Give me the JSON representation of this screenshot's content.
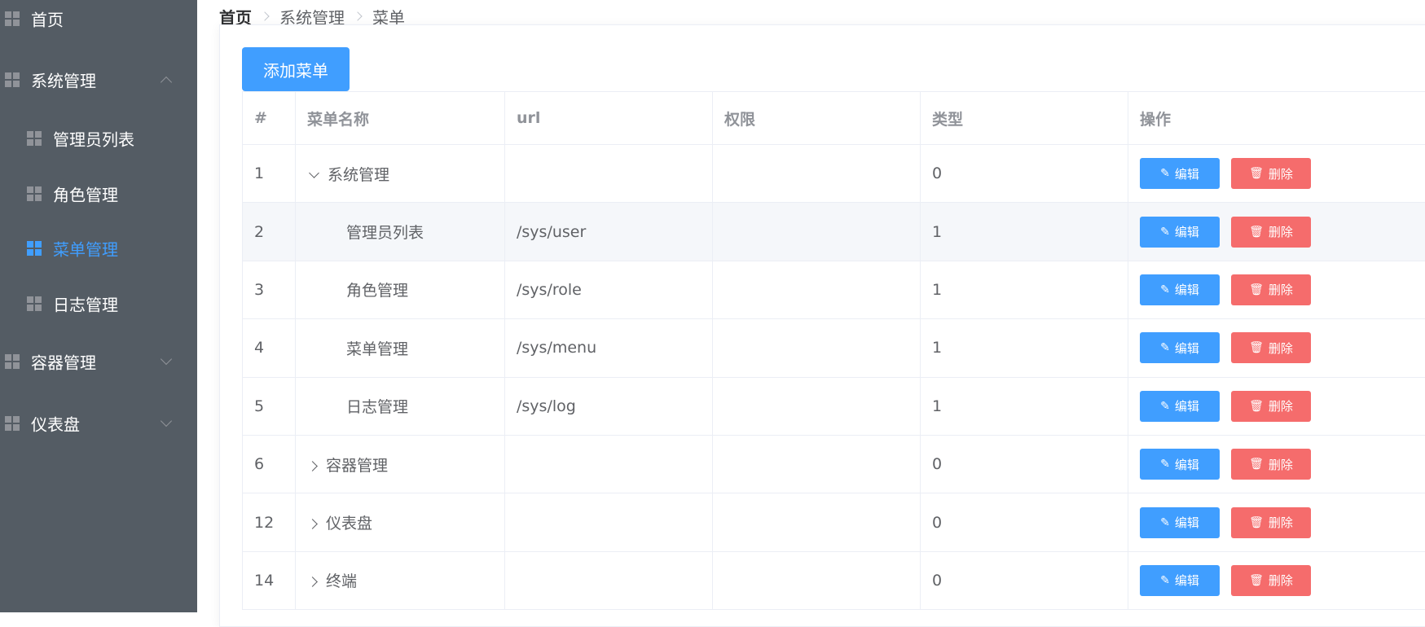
{
  "sidebar": {
    "items": [
      {
        "label": "首页",
        "icon": "grid-icon"
      },
      {
        "label": "系统管理",
        "icon": "grid-icon",
        "expanded": true
      },
      {
        "label": "管理员列表",
        "icon": "grid-icon"
      },
      {
        "label": "角色管理",
        "icon": "grid-icon"
      },
      {
        "label": "菜单管理",
        "icon": "grid-icon",
        "active": true
      },
      {
        "label": "日志管理",
        "icon": "grid-icon"
      },
      {
        "label": "容器管理",
        "icon": "grid-icon",
        "expanded": false
      },
      {
        "label": "仪表盘",
        "icon": "grid-icon",
        "expanded": false
      }
    ]
  },
  "breadcrumb": [
    "首页",
    "系统管理",
    "菜单"
  ],
  "toolbar": {
    "add_label": "添加菜单"
  },
  "table": {
    "headers": [
      "#",
      "菜单名称",
      "url",
      "权限",
      "类型",
      "操作"
    ],
    "edit_label": "编辑",
    "delete_label": "删除",
    "rows": [
      {
        "id": "1",
        "name": "系统管理",
        "url": "",
        "perm": "",
        "type": "0"
      },
      {
        "id": "2",
        "name": "管理员列表",
        "url": "/sys/user",
        "perm": "",
        "type": "1"
      },
      {
        "id": "3",
        "name": "角色管理",
        "url": "/sys/role",
        "perm": "",
        "type": "1"
      },
      {
        "id": "4",
        "name": "菜单管理",
        "url": "/sys/menu",
        "perm": "",
        "type": "1"
      },
      {
        "id": "5",
        "name": "日志管理",
        "url": "/sys/log",
        "perm": "",
        "type": "1"
      },
      {
        "id": "6",
        "name": "容器管理",
        "url": "",
        "perm": "",
        "type": "0"
      },
      {
        "id": "12",
        "name": "仪表盘",
        "url": "",
        "perm": "",
        "type": "0"
      },
      {
        "id": "14",
        "name": "终端",
        "url": "",
        "perm": "",
        "type": "0"
      }
    ]
  },
  "colors": {
    "sidebar_bg": "#545c64",
    "accent": "#409eff",
    "danger": "#f56c6c"
  }
}
